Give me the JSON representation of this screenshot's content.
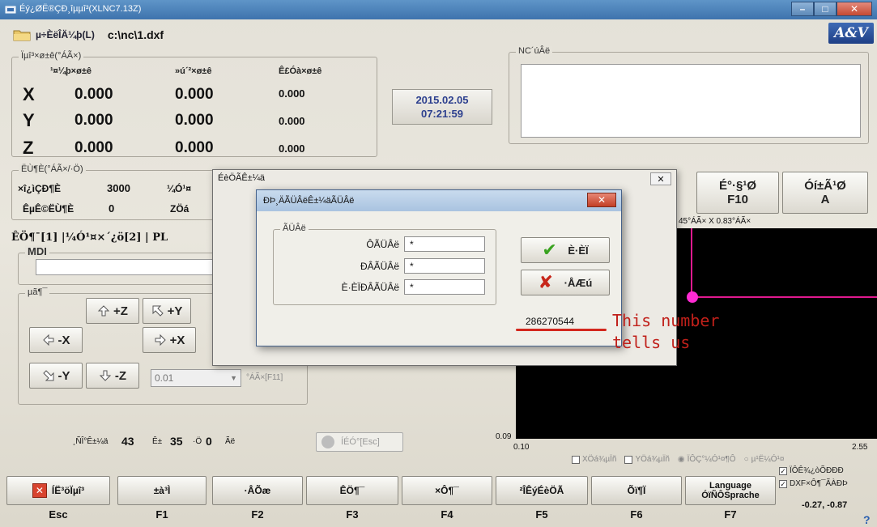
{
  "window": {
    "title": "Éý¿ØË®ÇÐ¸îµµî³(XLNC7.13Z)"
  },
  "toolbar": {
    "file_button": "µ÷ÈëÎÄ¼þ(L)",
    "file_path": "c:\\nc\\1.dxf",
    "logo": "A&V"
  },
  "coords": {
    "group_title": "Ïµî³×ø±ê(°ÁÃ×)",
    "headers": [
      "¹¤¼þ×ø±ê",
      "»ú´²×ø±ê",
      "Ê£Óà×ø±ê"
    ],
    "rows": [
      {
        "axis": "X",
        "work": "0.000",
        "machine": "0.000",
        "remain": "0.000"
      },
      {
        "axis": "Y",
        "work": "0.000",
        "machine": "0.000",
        "remain": "0.000"
      },
      {
        "axis": "Z",
        "work": "0.000",
        "machine": "0.000",
        "remain": "0.000"
      }
    ]
  },
  "datetime": {
    "date": "2015.02.05",
    "time": "07:21:59"
  },
  "nc": {
    "title": "NC´úÂë"
  },
  "speed": {
    "group_title": "ËÙ¶È(°ÁÃ×/·Ö)",
    "cut_label": "×î¿ìÇÐ¶È",
    "cut_value": "3000",
    "mid_label": "¼Ó¹¤",
    "feed_label": "ÊµÊ©ËÙ¶È",
    "feed_value": "0",
    "z_label": "ZÖá"
  },
  "tabs": {
    "text": "ÊÖ¶¯[1] |¼Ó¹¤×´¿ö[2] | PL"
  },
  "mdi": {
    "title": "MDI",
    "value": ""
  },
  "jog": {
    "group_title": "µã¶¯",
    "plus_z": "+Z",
    "plus_y": "+Y",
    "minus_x": "-X",
    "plus_x": "+X",
    "minus_y": "-Y",
    "minus_z": "-Z",
    "step_value": "0.01",
    "step_label": "°ÁÃ×[F11]"
  },
  "right_buttons": [
    {
      "label": "É°·§¹Ø",
      "key": "F10"
    },
    {
      "label": "Óí±Ã¹Ø",
      "key": "A"
    }
  ],
  "scale": {
    "text": "45°ÁÃ× X 0.83°ÁÃ×"
  },
  "graph": {
    "ymin": "0.09",
    "xmin": "0.10",
    "xmax": "2.55",
    "mirror_x": "XÖá¾µÏñ",
    "mirror_y": "YÖá¾µÏñ",
    "opt_a": "ÏÔÇ°¼Ó¹¤¶Ô",
    "opt_b": "µ¹Ë¼Ó¹¤",
    "show_label": "ÏÔÊ¾¿òÕÐÐÐ",
    "dxf_label": "DXF×Ô¶¯ÃÀÐÞ",
    "cursor": "-0.27, -0.87",
    "help": "?"
  },
  "status": {
    "cuts_label": "¸ÑÎ°Ê±¼ä",
    "cuts_value": "43",
    "sec_label": "Ê±",
    "sec_value": "35",
    "min_label": "·Ö",
    "min_value": "0",
    "sec_unit": "Ãë",
    "stop_button": "ÍÉÓ°[Esc]"
  },
  "dialog_outer": {
    "title": "ÉèÖÃÊ±¼ä",
    "close": "✕"
  },
  "dialog_inner": {
    "title": "ÐÞ¸ÄÃÜÂëÊ±¼äÃÜÂë",
    "close": "✕",
    "group_title": "ÃÜÂë",
    "fields": [
      {
        "label": "Ô­ÃÜÂë",
        "value": "*"
      },
      {
        "label": "ÐÂÃÜÂë",
        "value": "*"
      },
      {
        "label": "È·ÈÏÐÂÃÜÂë",
        "value": "*"
      }
    ],
    "ok": "È·ÈÏ",
    "cancel": "·ÅÆú",
    "serial": "286270544"
  },
  "annotation": {
    "line1": "This number",
    "line2": "tells us"
  },
  "fkeys": [
    {
      "label": "ÍË³öÏµî³",
      "key": "Esc"
    },
    {
      "label": "±à³Ì",
      "key": "F1"
    },
    {
      "label": "·ÂÕæ",
      "key": "F2"
    },
    {
      "label": "ÊÖ¶¯",
      "key": "F3"
    },
    {
      "label": "×Ô¶¯",
      "key": "F4"
    },
    {
      "label": "²ÎÊýÉèÖÃ",
      "key": "F5"
    },
    {
      "label": "Õï¶Ï",
      "key": "F6"
    },
    {
      "label": "Language",
      "label2": "ÓïÑÔSprache",
      "key": "F7"
    }
  ],
  "colors": {
    "titlebar": "#4a7fb8",
    "accent_text": "#2c3f8e",
    "annotation": "#c0201a",
    "marker": "#ff2bd3"
  }
}
